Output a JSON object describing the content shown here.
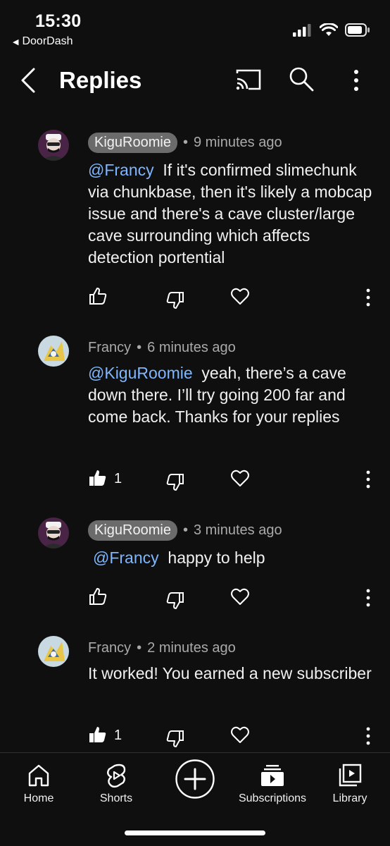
{
  "status_bar": {
    "time": "15:30",
    "back_app": "DoorDash"
  },
  "header": {
    "title": "Replies"
  },
  "comments": [
    {
      "author": "KiguRoomie",
      "author_style": "pill",
      "time": "9 minutes ago",
      "mention": "@Francy",
      "text": "If it's confirmed slimechunk via chunkbase, then it's likely a mobcap issue and there's a cave cluster/large cave surrounding which affects detection portential",
      "likes": "",
      "liked": false
    },
    {
      "author": "Francy",
      "author_style": "plain",
      "time": "6 minutes ago",
      "mention": "@KiguRoomie",
      "text": "yeah, there’s a cave down there. I’ll try going 200 far and come back. Thanks for your replies",
      "likes": "1",
      "liked": true
    },
    {
      "author": "KiguRoomie",
      "author_style": "pill",
      "time": "3 minutes ago",
      "mention": "@Francy",
      "text": "happy to help",
      "likes": "",
      "liked": false
    },
    {
      "author": "Francy",
      "author_style": "plain",
      "time": "2 minutes ago",
      "mention": "",
      "text": "It worked! You earned a new subscriber",
      "likes": "1",
      "liked": true
    }
  ],
  "bottom_nav": {
    "items": [
      {
        "label": "Home",
        "icon": "home-icon"
      },
      {
        "label": "Shorts",
        "icon": "shorts-icon"
      },
      {
        "label": "",
        "icon": "create-plus-icon"
      },
      {
        "label": "Subscriptions",
        "icon": "subscriptions-icon"
      },
      {
        "label": "Library",
        "icon": "library-icon"
      }
    ]
  },
  "colors": {
    "background": "#0f0f0f",
    "mention": "#7eb6ff",
    "pill": "#6b6b6b",
    "secondary_text": "#aaaaaa"
  }
}
